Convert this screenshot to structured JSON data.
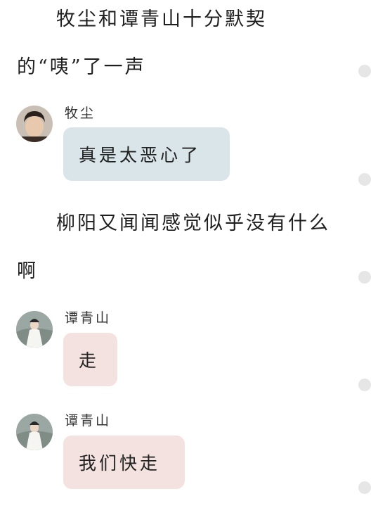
{
  "narration": [
    "牧尘和谭青山十分默契的“咦”了一声",
    "柳阳又闻闻感觉似乎没有什么啊"
  ],
  "messages": [
    {
      "speaker": "牧尘",
      "text": "真是太恶心了",
      "bubble_color": "#dae5ea",
      "avatar": "young-man-portrait"
    },
    {
      "speaker": "谭青山",
      "text": "走",
      "bubble_color": "#f3e2df",
      "avatar": "white-robed-figure"
    },
    {
      "speaker": "谭青山",
      "text": "我们快走",
      "bubble_color": "#f3e2df",
      "avatar": "white-robed-figure"
    }
  ]
}
